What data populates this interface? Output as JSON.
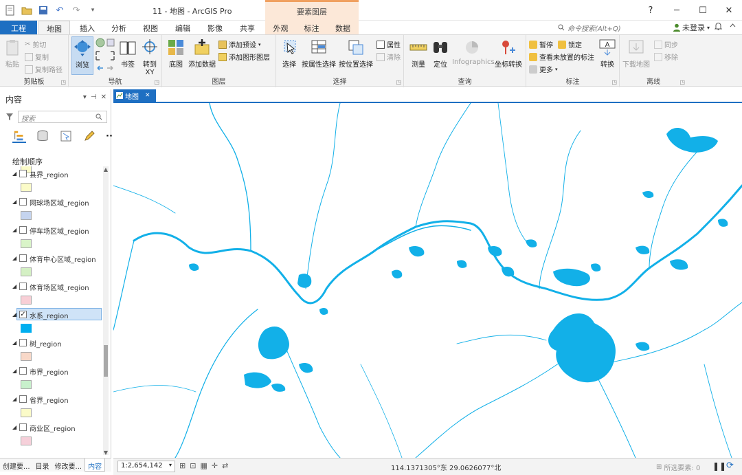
{
  "window": {
    "title": "11 - 地图 - ArcGIS Pro",
    "context_tab_title": "要素图层",
    "controls": [
      "?",
      "─",
      "☐",
      "✕"
    ]
  },
  "tabs": {
    "project": "工程",
    "items": [
      "地图",
      "插入",
      "分析",
      "视图",
      "编辑",
      "影像",
      "共享"
    ],
    "context": [
      "外观",
      "标注",
      "数据"
    ]
  },
  "header_right": {
    "search_placeholder": "命令搜索(Alt+Q)",
    "login": "未登录",
    "login_arrow": "▾"
  },
  "ribbon": {
    "clipboard": {
      "label": "剪贴板",
      "paste": "粘贴",
      "cut": "剪切",
      "copy": "复制",
      "copy_path": "复制路径"
    },
    "navigate": {
      "label": "导航",
      "explore": "浏览",
      "bookmarks": "书签",
      "goto_xy_line1": "转到",
      "goto_xy_line2": "XY"
    },
    "layer": {
      "label": "图层",
      "basemap": "底图",
      "add_data": "添加数据",
      "add_preset": "添加预设",
      "add_graphics": "添加图形图层"
    },
    "selection": {
      "label": "选择",
      "select": "选择",
      "by_attribute": "按属性选择",
      "by_location": "按位置选择",
      "attributes": "属性",
      "clear": "清除"
    },
    "inquiry": {
      "label": "查询",
      "measure": "测量",
      "locate": "定位",
      "infographics": "Infographics",
      "coord_convert": "坐标转换"
    },
    "labeling": {
      "label": "标注",
      "pause": "暂停",
      "lock": "锁定",
      "unplaced": "查看未放置的标注",
      "more": "更多",
      "convert": "转换"
    },
    "offline": {
      "label": "离线",
      "download_map": "下载地图",
      "sync": "同步",
      "remove": "移除"
    }
  },
  "contents_panel": {
    "title": "内容",
    "search_placeholder": "搜索",
    "draw_order_label": "绘制顺序",
    "layers": [
      {
        "name": "县界_region",
        "checked": false,
        "color": "#fbfbc8"
      },
      {
        "name": "网球场区域_region",
        "checked": false,
        "color": "#c5d4ef"
      },
      {
        "name": "停车场区域_region",
        "checked": false,
        "color": "#d9f4c8"
      },
      {
        "name": "体育中心区域_region",
        "checked": false,
        "color": "#d4f0c4"
      },
      {
        "name": "体育场区域_region",
        "checked": false,
        "color": "#f8cfd6"
      },
      {
        "name": "水系_region",
        "checked": true,
        "selected": true,
        "color": "#00aeef"
      },
      {
        "name": "树_region",
        "checked": false,
        "color": "#f8d8c8"
      },
      {
        "name": "市界_region",
        "checked": false,
        "color": "#c8f0cc"
      },
      {
        "name": "省界_region",
        "checked": false,
        "color": "#fbfbc8"
      },
      {
        "name": "商业区_region",
        "checked": false,
        "color": "#f6d0da"
      }
    ],
    "bottom_tabs": [
      "创建要...",
      "目录",
      "修改要...",
      "内容"
    ]
  },
  "map": {
    "tab_label": "地图",
    "water_color": "#12b0e8"
  },
  "status": {
    "scale": "1:2,654,142",
    "coordinates": "114.1371305°东 29.0626077°北",
    "selected_features": "所选要素: 0"
  }
}
